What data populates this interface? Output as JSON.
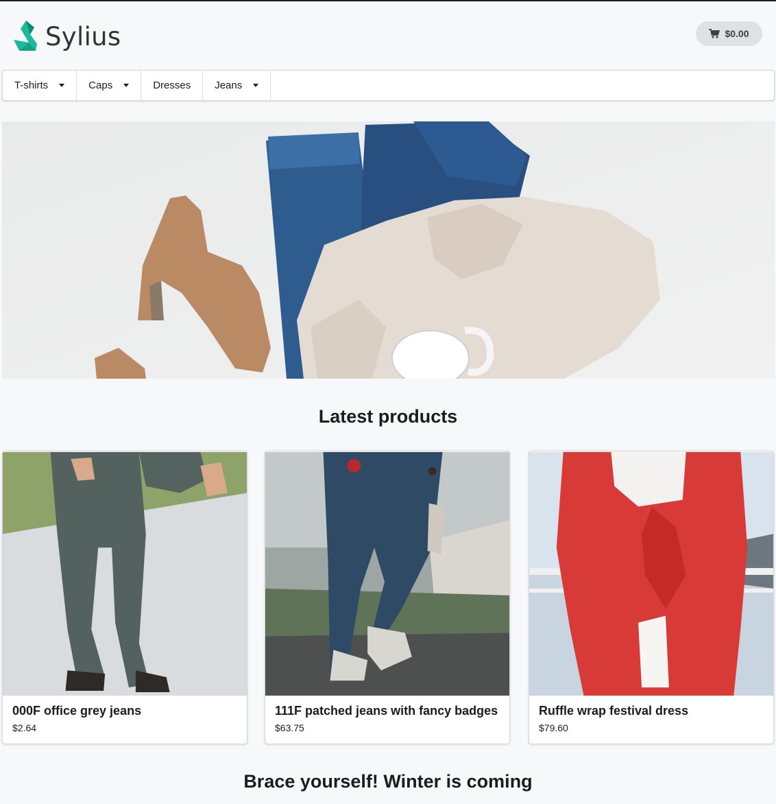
{
  "brand": {
    "name": "Sylius",
    "logo_color": "#1abb9c"
  },
  "cart": {
    "total": "$0.00",
    "icon": "cart-icon"
  },
  "menu": {
    "items": [
      {
        "label": "T-shirts",
        "has_dropdown": true
      },
      {
        "label": "Caps",
        "has_dropdown": true
      },
      {
        "label": "Dresses",
        "has_dropdown": false
      },
      {
        "label": "Jeans",
        "has_dropdown": true
      }
    ]
  },
  "hero": {
    "alt": "Flat lay with boots, jeans, sweater and mug"
  },
  "sections": {
    "latest_title": "Latest products",
    "winter_title": "Brace yourself! Winter is coming"
  },
  "products": [
    {
      "name": "000F office grey jeans",
      "price": "$2.64"
    },
    {
      "name": "111F patched jeans with fancy badges",
      "price": "$63.75"
    },
    {
      "name": "Ruffle wrap festival dress",
      "price": "$79.60"
    }
  ]
}
